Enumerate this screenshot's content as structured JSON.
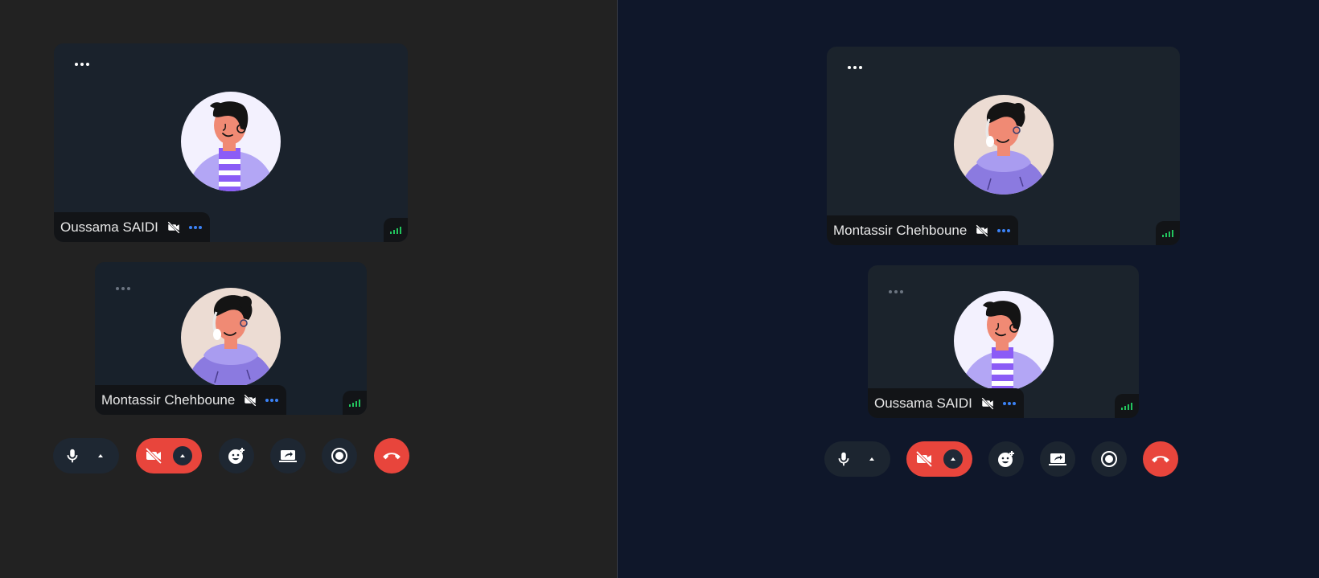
{
  "left_view": {
    "main_tile": {
      "participant": "Oussama SAIDI",
      "camera": "off",
      "menu_icon": "more-horizontal-icon",
      "signal_icon": "signal-strength-icon"
    },
    "self_tile": {
      "participant": "Montassir Chehboune",
      "camera": "off",
      "menu_icon": "more-horizontal-icon",
      "signal_icon": "signal-strength-icon"
    }
  },
  "right_view": {
    "main_tile": {
      "participant": "Montassir Chehboune",
      "camera": "off",
      "menu_icon": "more-horizontal-icon",
      "signal_icon": "signal-strength-icon"
    },
    "self_tile": {
      "participant": "Oussama SAIDI",
      "camera": "off",
      "menu_icon": "more-horizontal-icon",
      "signal_icon": "signal-strength-icon"
    }
  },
  "controls": [
    "microphone-icon",
    "caret-up-icon",
    "video-off-icon",
    "reaction-icon",
    "screen-share-icon",
    "record-icon",
    "end-call-icon"
  ],
  "colors": {
    "left_background": "#222222",
    "right_background": "#0f172a",
    "tile_background": "#1a222c",
    "danger": "#e8453c",
    "signal": "#22c55e",
    "more_dots": "#3b82f6"
  }
}
